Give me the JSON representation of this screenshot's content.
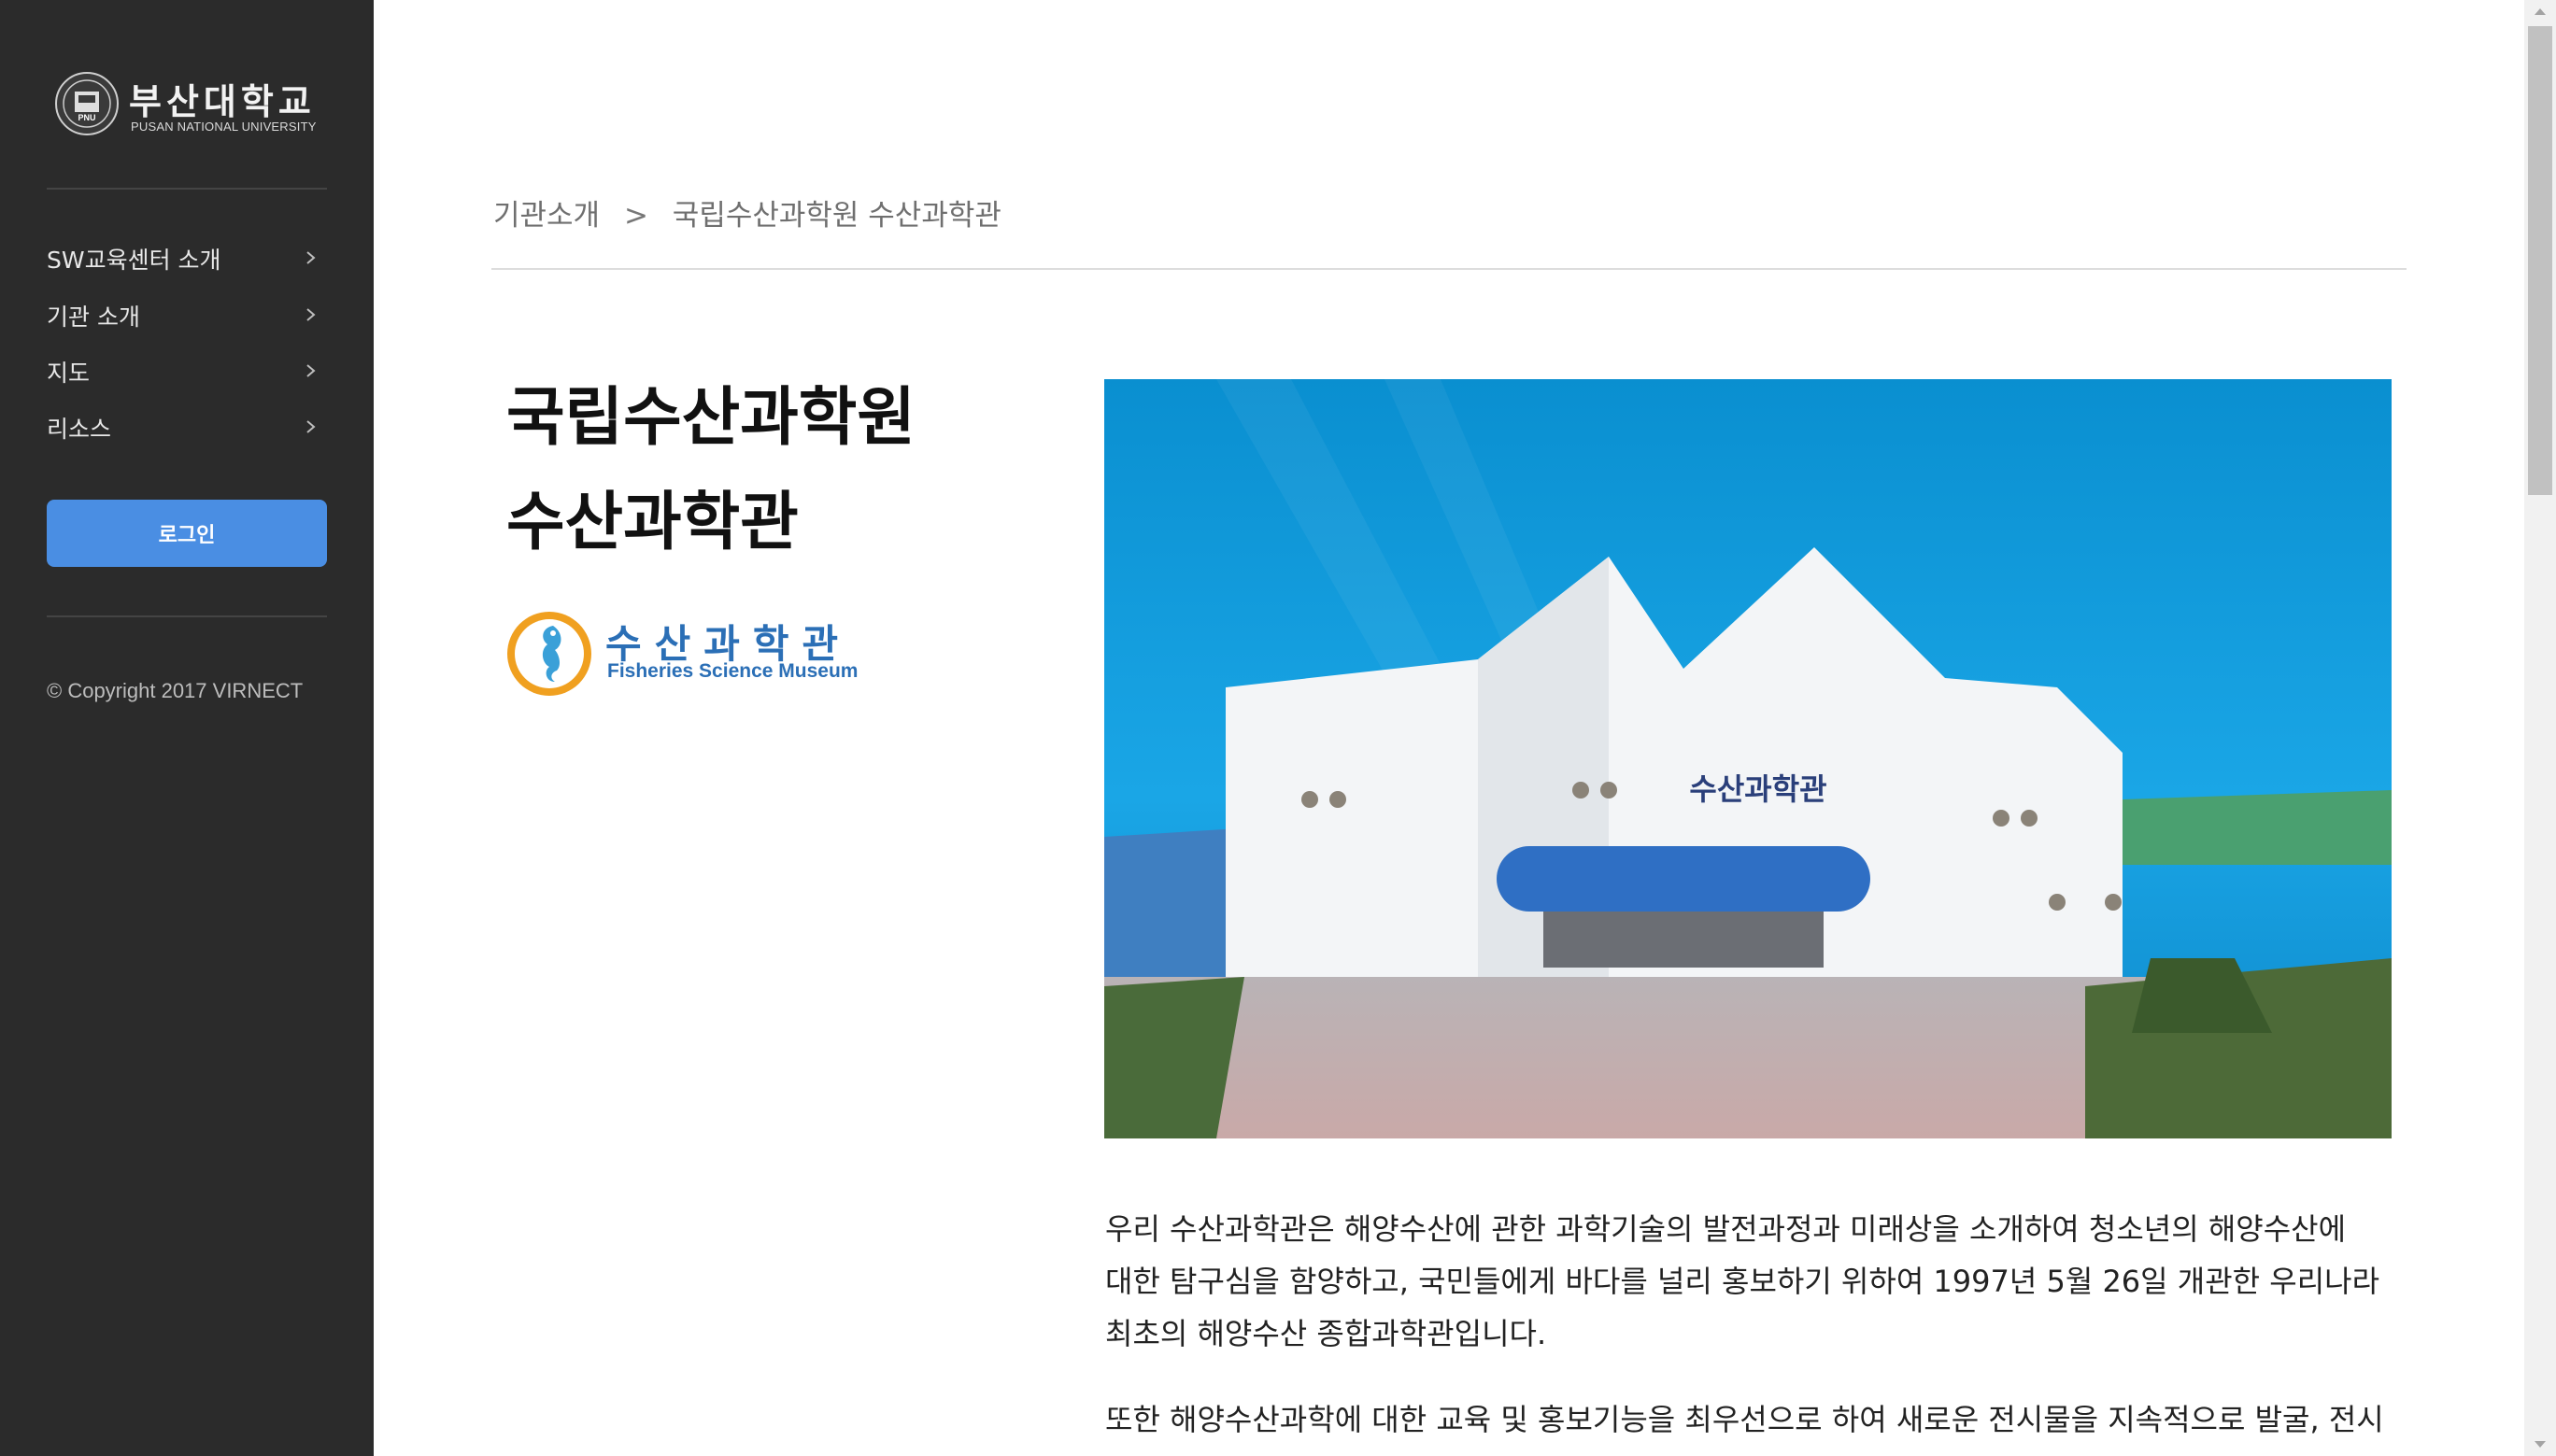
{
  "sidebar": {
    "logo": {
      "name_kr": "부산대학교",
      "name_en": "PUSAN NATIONAL UNIVERSITY",
      "seal_text": "PNU"
    },
    "items": [
      {
        "label": "SW교육센터 소개"
      },
      {
        "label": "기관 소개"
      },
      {
        "label": "지도"
      },
      {
        "label": "리소스"
      }
    ],
    "login_label": "로그인",
    "copyright": "© Copyright 2017 VIRNECT"
  },
  "breadcrumb": {
    "items": [
      "기관소개",
      "국립수산과학원 수산과학관"
    ],
    "separator": ">"
  },
  "page": {
    "title_line1": "국립수산과학원",
    "title_line2": "수산과학관",
    "museum_logo": {
      "name_kr": "수산과학관",
      "name_en": "Fisheries Science Museum"
    },
    "hero_sign": "수산과학관",
    "paragraphs": [
      "우리 수산과학관은 해양수산에 관한 과학기술의 발전과정과 미래상을 소개하여 청소년의 해양수산에 대한 탐구심을 함양하고, 국민들에게 바다를 널리 홍보하기 위하여 1997년 5월 26일 개관한 우리나라 최초의 해양수산 종합과학관입니다.",
      "또한 해양수산과학에 대한 교육 및 홍보기능을 최우선으로 하여 새로운 전시물을 지속적으로 발굴, 전시"
    ]
  },
  "colors": {
    "sidebar_bg": "#2b2b2b",
    "accent": "#4a8ee3",
    "museum_blue": "#2b6fb6",
    "text": "#222222"
  },
  "icons": {
    "nav_chevron": "chevron-right-icon",
    "scroll_up": "scroll-up-arrow-icon",
    "scroll_down": "scroll-down-arrow-icon"
  }
}
